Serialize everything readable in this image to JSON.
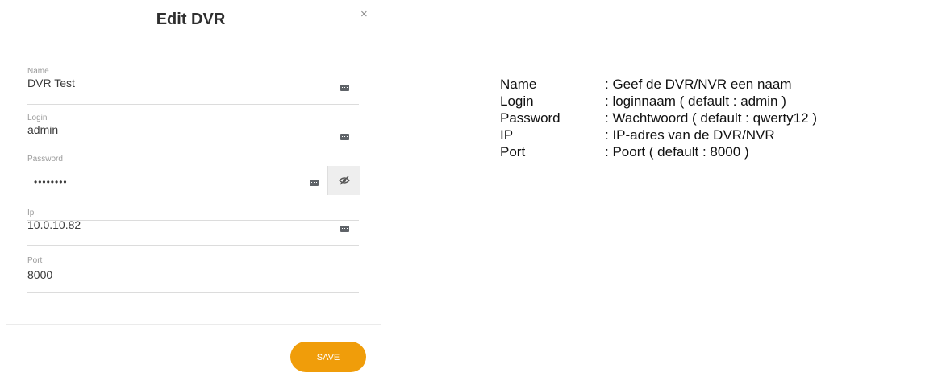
{
  "dialog": {
    "title": "Edit DVR",
    "close_symbol": "×",
    "fields": [
      {
        "label": "Name",
        "value": "DVR Test"
      },
      {
        "label": "Login",
        "value": "admin"
      },
      {
        "label": "Password",
        "value": "••••••••"
      },
      {
        "label": "Ip",
        "value": "10.0.10.82"
      },
      {
        "label": "Port",
        "value": "8000"
      }
    ],
    "save_label": "SAVE"
  },
  "info": [
    {
      "key": "Name",
      "value": ": Geef de DVR/NVR een naam"
    },
    {
      "key": "Login",
      "value": ": loginnaam ( default : admin )"
    },
    {
      "key": "Password",
      "value": ": Wachtwoord ( default : qwerty12 )"
    },
    {
      "key": "IP",
      "value": ": IP-adres van de DVR/NVR"
    },
    {
      "key": "Port",
      "value": ": Poort ( default : 8000 )"
    }
  ],
  "colors": {
    "save_button": "#f09d0a",
    "title_text": "#2f2f2f",
    "label_text": "#9a9a9a"
  },
  "icons": {
    "close": "close-icon",
    "field_menu": "more-dots-icon",
    "password_toggle": "eye-slash-icon"
  }
}
